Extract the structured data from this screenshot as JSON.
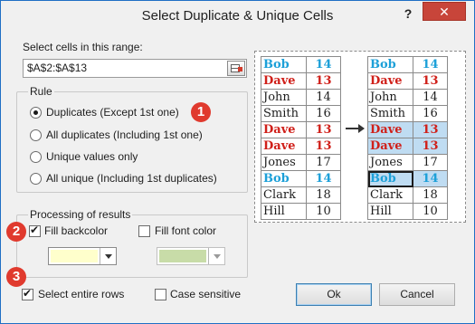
{
  "window": {
    "title": "Select Duplicate & Unique Cells",
    "help_label": "?",
    "close_label": "✕"
  },
  "range": {
    "label": "Select cells in this range:",
    "value": "$A$2:$A$13"
  },
  "rule": {
    "title": "Rule",
    "badge": "1",
    "options": [
      {
        "label": "Duplicates (Except 1st one)",
        "checked": true
      },
      {
        "label": "All duplicates (Including 1st one)",
        "checked": false
      },
      {
        "label": "Unique values only",
        "checked": false
      },
      {
        "label": "All unique (Including 1st duplicates)",
        "checked": false
      }
    ]
  },
  "processing": {
    "title": "Processing of results",
    "badge": "2",
    "fill_backcolor_label": "Fill backcolor",
    "fill_backcolor_checked": true,
    "fill_backcolor_color": "#ffffcc",
    "fill_font_color_label": "Fill font color",
    "fill_font_color_checked": false,
    "font_color": "#c8dca8"
  },
  "footer": {
    "badge": "3",
    "select_entire_rows_label": "Select entire rows",
    "select_entire_rows_checked": true,
    "case_sensitive_label": "Case sensitive",
    "case_sensitive_checked": false,
    "ok_label": "Ok",
    "cancel_label": "Cancel"
  },
  "preview": {
    "left_rows": [
      {
        "name": "Bob",
        "value": "14",
        "style": "cyan"
      },
      {
        "name": "Dave",
        "value": "13",
        "style": "red"
      },
      {
        "name": "John",
        "value": "14",
        "style": "plain"
      },
      {
        "name": "Smith",
        "value": "16",
        "style": "plain"
      },
      {
        "name": "Dave",
        "value": "13",
        "style": "red"
      },
      {
        "name": "Dave",
        "value": "13",
        "style": "red"
      },
      {
        "name": "Jones",
        "value": "17",
        "style": "plain"
      },
      {
        "name": "Bob",
        "value": "14",
        "style": "cyan"
      },
      {
        "name": "Clark",
        "value": "18",
        "style": "plain"
      },
      {
        "name": "Hill",
        "value": "10",
        "style": "plain"
      }
    ],
    "right_rows": [
      {
        "name": "Bob",
        "value": "14",
        "style": "cyan",
        "highlight": false,
        "selected": false
      },
      {
        "name": "Dave",
        "value": "13",
        "style": "red",
        "highlight": false,
        "selected": false
      },
      {
        "name": "John",
        "value": "14",
        "style": "plain",
        "highlight": false,
        "selected": false
      },
      {
        "name": "Smith",
        "value": "16",
        "style": "plain",
        "highlight": false,
        "selected": false
      },
      {
        "name": "Dave",
        "value": "13",
        "style": "red",
        "highlight": true,
        "selected": false
      },
      {
        "name": "Dave",
        "value": "13",
        "style": "red",
        "highlight": true,
        "selected": false
      },
      {
        "name": "Jones",
        "value": "17",
        "style": "plain",
        "highlight": false,
        "selected": false
      },
      {
        "name": "Bob",
        "value": "14",
        "style": "cyan",
        "highlight": true,
        "selected": true
      },
      {
        "name": "Clark",
        "value": "18",
        "style": "plain",
        "highlight": false,
        "selected": false
      },
      {
        "name": "Hill",
        "value": "10",
        "style": "plain",
        "highlight": false,
        "selected": false
      }
    ]
  }
}
